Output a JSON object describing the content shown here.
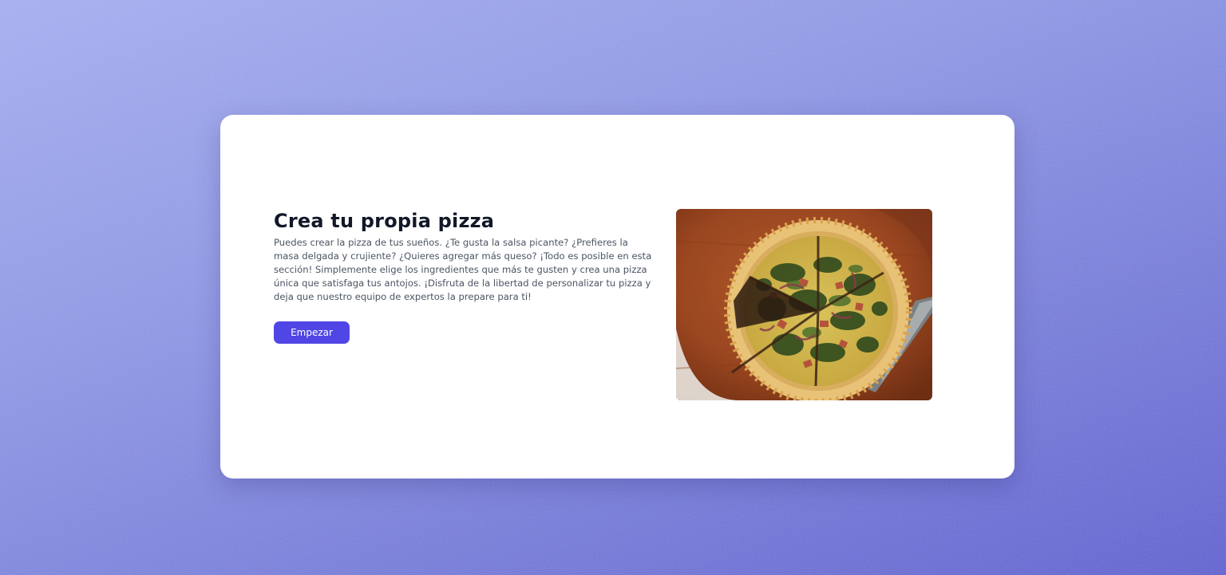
{
  "hero": {
    "title": "Crea tu propia pizza",
    "description": "Puedes crear la pizza de tus sueños. ¿Te gusta la salsa picante? ¿Prefieres la masa delgada y crujiente? ¿Quieres agregar más queso? ¡Todo es posible en esta sección! Simplemente elige los ingredientes que más te gusten y crea una pizza única que satisfaga tus antojos. ¡Disfruta de la libertad de personalizar tu pizza y deja que nuestro equipo de expertos la prepare para ti!",
    "button_label": "Empezar",
    "image_alt": "Pizza de espinaca sobre tabla de madera"
  },
  "colors": {
    "background_start": "#a6b0fb",
    "background_end": "#5a5ad6",
    "accent": "#4f46e5",
    "title": "#111827",
    "text": "#4b5563"
  }
}
